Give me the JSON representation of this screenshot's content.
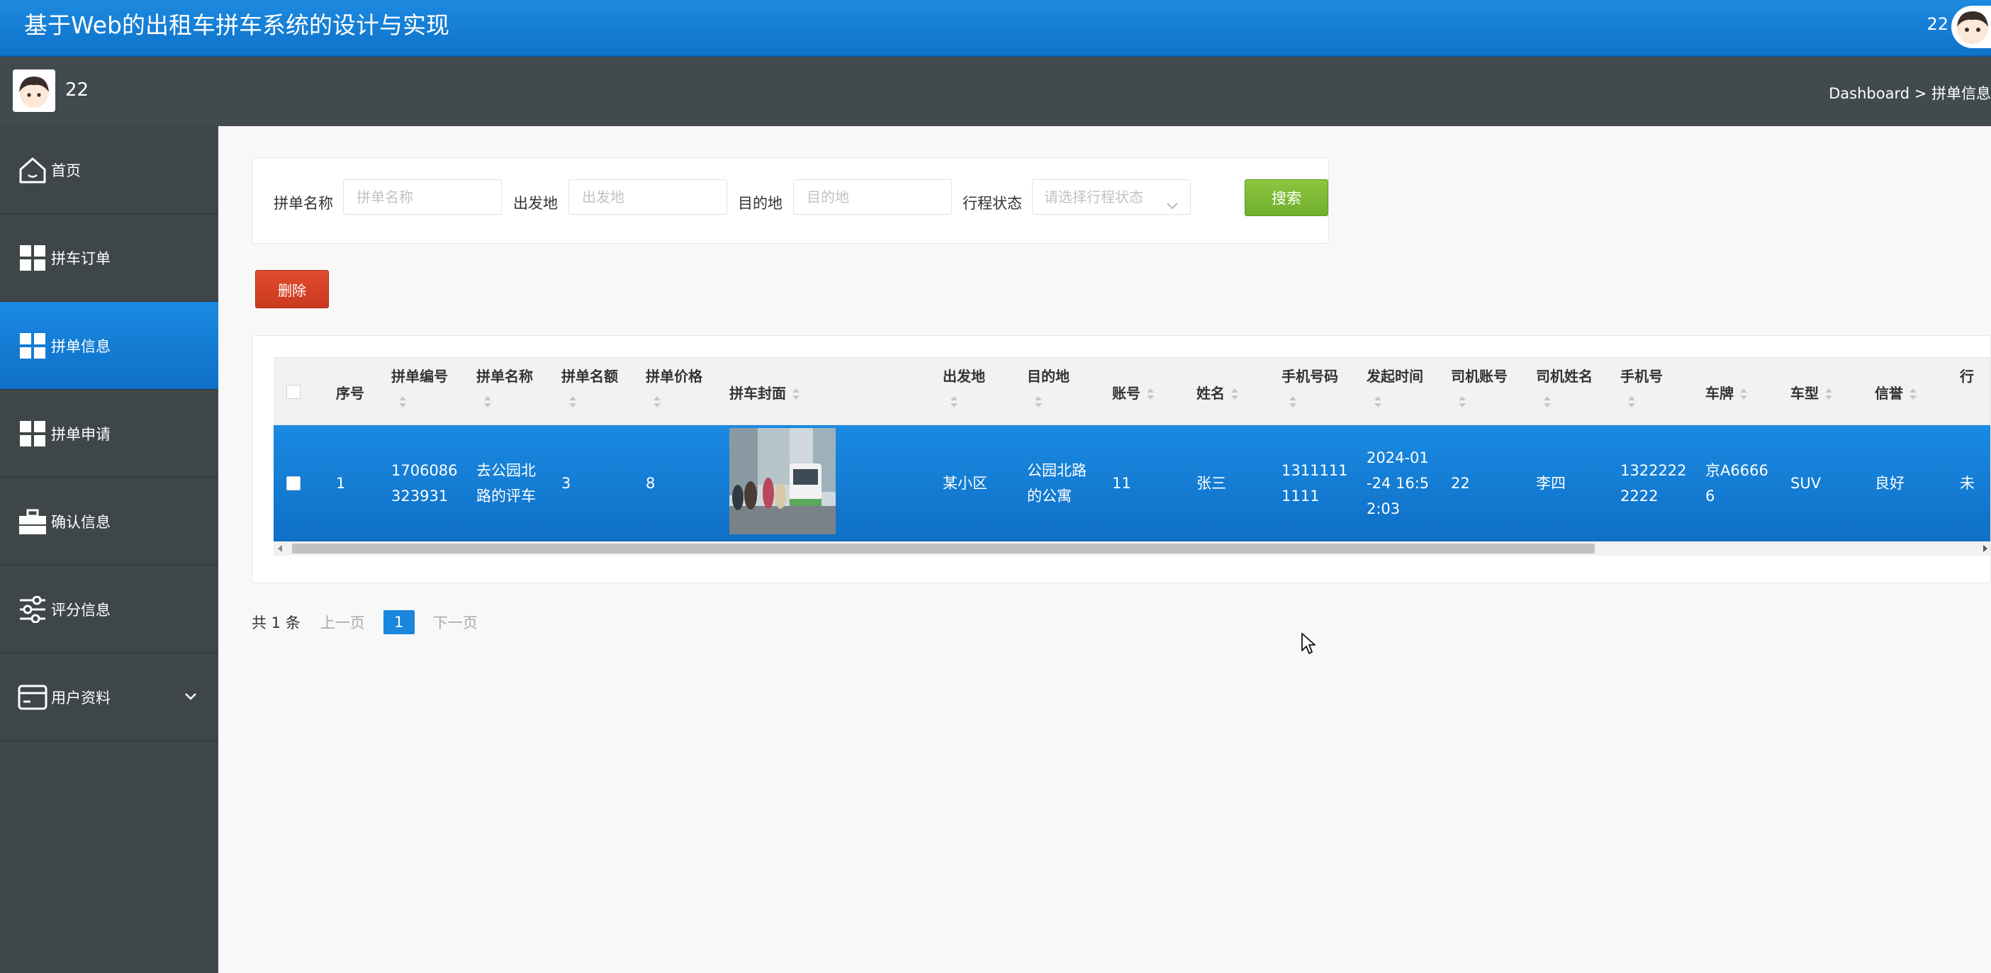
{
  "header": {
    "title": "基于Web的出租车拼车系统的设计与实现",
    "user_name": "22"
  },
  "subbar": {
    "user_name": "22",
    "breadcrumb": "Dashboard > 拼单信息"
  },
  "sidebar": {
    "items": [
      {
        "label": "首页",
        "icon": "home-icon",
        "active": false
      },
      {
        "label": "拼车订单",
        "icon": "grid-icon",
        "active": false
      },
      {
        "label": "拼单信息",
        "icon": "grid-icon",
        "active": true
      },
      {
        "label": "拼单申请",
        "icon": "grid-icon",
        "active": false
      },
      {
        "label": "确认信息",
        "icon": "briefcase-icon",
        "active": false
      },
      {
        "label": "评分信息",
        "icon": "sliders-icon",
        "active": false
      },
      {
        "label": "用户资料",
        "icon": "card-icon",
        "active": false
      }
    ]
  },
  "search": {
    "name_label": "拼单名称",
    "name_placeholder": "拼单名称",
    "origin_label": "出发地",
    "origin_placeholder": "出发地",
    "dest_label": "目的地",
    "dest_placeholder": "目的地",
    "status_label": "行程状态",
    "status_placeholder": "请选择行程状态",
    "search_button": "搜索"
  },
  "actions": {
    "delete_button": "删除"
  },
  "table": {
    "headers": {
      "index": "序号",
      "code": "拼单编号",
      "name": "拼单名称",
      "quota": "拼单名额",
      "price": "拼单价格",
      "cover": "拼车封面",
      "origin": "出发地",
      "dest": "目的地",
      "account": "账号",
      "realname": "姓名",
      "phone": "手机号码",
      "start_time": "发起时间",
      "driver_account": "司机账号",
      "driver_name": "司机姓名",
      "driver_phone": "手机号",
      "plate": "车牌",
      "car_type": "车型",
      "credit": "信誉",
      "status": "行"
    },
    "row": {
      "index": "1",
      "code_l1": "1706086",
      "code_l2": "323931",
      "name_l1": "去公园北",
      "name_l2": "路的评车",
      "quota": "3",
      "price": "8",
      "origin": "某小区",
      "dest_l1": "公园北路",
      "dest_l2": "的公寓",
      "account": "11",
      "realname": "张三",
      "phone_l1": "1311111",
      "phone_l2": "1111",
      "time_l1": "2024-01",
      "time_l2": "-24 16:5",
      "time_l3": "2:03",
      "driver_account": "22",
      "driver_name": "李四",
      "driver_phone_l1": "1322222",
      "driver_phone_l2": "2222",
      "plate_l1": "京A6666",
      "plate_l2": "6",
      "car_type": "SUV",
      "credit": "良好",
      "status": "未"
    }
  },
  "pager": {
    "total": "共 1 条",
    "prev": "上一页",
    "current": "1",
    "next": "下一页"
  },
  "colors": {
    "primary": "#1a86dc",
    "sidebar_bg": "#3e4648",
    "subbar_bg": "#414a4c",
    "search_green": "#7cb936",
    "delete_red": "#d6432a"
  }
}
